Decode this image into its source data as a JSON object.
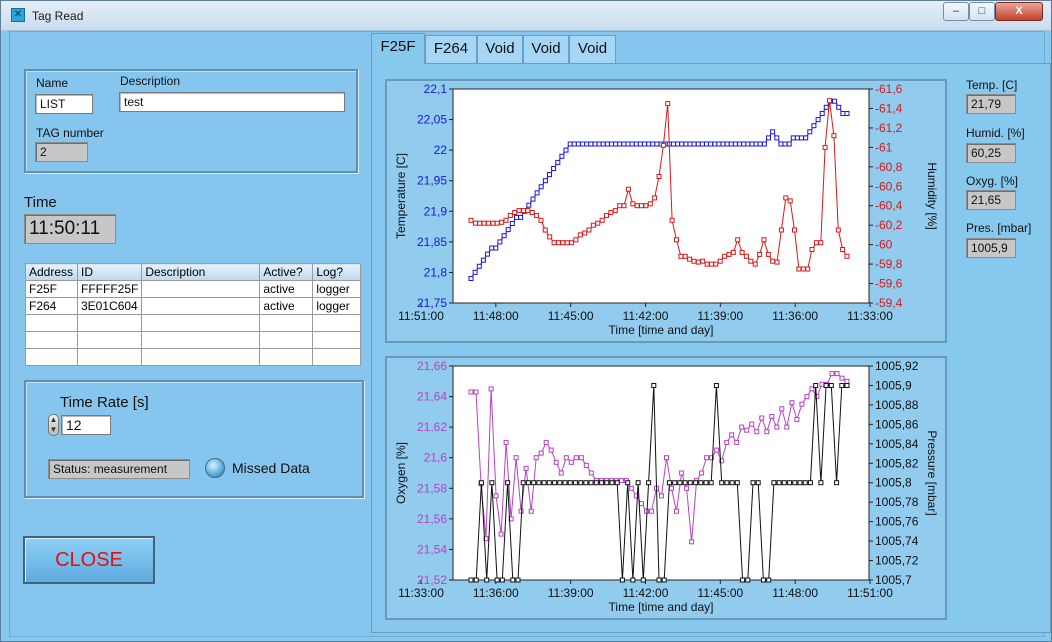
{
  "window": {
    "title": "Tag Read",
    "controls": [
      "–",
      "□",
      "X"
    ]
  },
  "tag_panel": {
    "name_label": "Name",
    "name_value": "LIST",
    "description_label": "Description",
    "description_value": "test",
    "tag_number_label": "TAG number",
    "tag_number_value": "2"
  },
  "time": {
    "label": "Time",
    "value": "11:50:11"
  },
  "tag_table": {
    "columns": [
      "Address",
      "ID",
      "Description",
      "Active?",
      "Log?"
    ],
    "rows": [
      [
        "F25F",
        "FFFFF25F",
        "",
        "active",
        "logger"
      ],
      [
        "F264",
        "3E01C604",
        "",
        "active",
        "logger"
      ],
      [
        "",
        "",
        "",
        "",
        ""
      ],
      [
        "",
        "",
        "",
        "",
        ""
      ],
      [
        "",
        "",
        "",
        "",
        ""
      ]
    ]
  },
  "rate_panel": {
    "label": "Time Rate [s]",
    "value": "12",
    "status": "Status: measurement",
    "missed_data": "Missed Data"
  },
  "close_button": "CLOSE",
  "tabs": [
    "F25F",
    "F264",
    "Void",
    "Void",
    "Void"
  ],
  "readouts": [
    {
      "label": "Temp. [C]",
      "value": "21,79"
    },
    {
      "label": "Humid. [%]",
      "value": "60,25"
    },
    {
      "label": "Oxyg. [%]",
      "value": "21,65"
    },
    {
      "label": "Pres. [mbar]",
      "value": "1005,9"
    }
  ],
  "colors": {
    "temperature": "#1a1ad6",
    "humidity": "#d61a1a",
    "oxygen": "#b542c4",
    "pressure": "#111111",
    "panel": "#87c8ef",
    "close_text": "#e11111"
  },
  "chart_data": [
    {
      "type": "line",
      "xlabel": "Time [time and day]",
      "ylabel": "Temperature [C]",
      "y2label": "Humidity [%]",
      "x_ticks": [
        "11:51:00",
        "11:48:00",
        "11:45:00",
        "11:42:00",
        "11:39:00",
        "11:36:00",
        "11:33:00"
      ],
      "y_ticks": [
        "21,75",
        "21,8",
        "21,85",
        "21,9",
        "21,95",
        "22",
        "22,05",
        "22,1"
      ],
      "y2_ticks": [
        "-59,4",
        "-59,6",
        "-59,8",
        "-60",
        "-60,2",
        "-60,4",
        "-60,6",
        "-60,8",
        "-61",
        "-61,2",
        "-61,4",
        "-61,6"
      ],
      "ylim": [
        21.75,
        22.1
      ],
      "y2lim": [
        -59.4,
        -61.6
      ],
      "series": [
        {
          "name": "Temperature [C]",
          "color": "#1a1ad6",
          "values": [
            21.79,
            21.8,
            21.81,
            21.82,
            21.83,
            21.84,
            21.84,
            21.85,
            21.86,
            21.87,
            21.88,
            21.89,
            21.89,
            21.9,
            21.91,
            21.92,
            21.93,
            21.94,
            21.95,
            21.96,
            21.97,
            21.98,
            21.99,
            22.0,
            22.01,
            22.01,
            22.01,
            22.01,
            22.01,
            22.01,
            22.01,
            22.01,
            22.01,
            22.01,
            22.01,
            22.01,
            22.01,
            22.01,
            22.01,
            22.01,
            22.01,
            22.01,
            22.01,
            22.01,
            22.01,
            22.01,
            22.01,
            22.01,
            22.01,
            22.01,
            22.01,
            22.01,
            22.01,
            22.01,
            22.01,
            22.01,
            22.01,
            22.01,
            22.01,
            22.01,
            22.01,
            22.01,
            22.01,
            22.01,
            22.01,
            22.01,
            22.01,
            22.01,
            22.01,
            22.01,
            22.01,
            22.01,
            22.02,
            22.03,
            22.02,
            22.01,
            22.01,
            22.01,
            22.02,
            22.02,
            22.02,
            22.02,
            22.03,
            22.04,
            22.05,
            22.06,
            22.07,
            22.08,
            22.08,
            22.07,
            22.06,
            22.06
          ]
        },
        {
          "name": "Humidity [%]",
          "color": "#d61a1a",
          "axis": "right",
          "values": [
            -60.25,
            -60.22,
            -60.22,
            -60.22,
            -60.22,
            -60.22,
            -60.22,
            -60.23,
            -60.25,
            -60.3,
            -60.33,
            -60.35,
            -60.35,
            -60.35,
            -60.33,
            -60.3,
            -60.25,
            -60.15,
            -60.08,
            -60.02,
            -60.02,
            -60.02,
            -60.02,
            -60.02,
            -60.05,
            -60.1,
            -60.12,
            -60.15,
            -60.2,
            -60.22,
            -60.25,
            -60.3,
            -60.33,
            -60.35,
            -60.4,
            -60.4,
            -60.57,
            -60.42,
            -60.4,
            -60.4,
            -60.4,
            -60.42,
            -60.48,
            -60.7,
            -61.02,
            -61.45,
            -60.25,
            -60.05,
            -59.88,
            -59.88,
            -59.85,
            -59.83,
            -59.82,
            -59.83,
            -59.8,
            -59.8,
            -59.8,
            -59.83,
            -59.88,
            -59.9,
            -59.92,
            -60.05,
            -59.92,
            -59.88,
            -59.83,
            -59.8,
            -59.9,
            -60.05,
            -59.9,
            -59.83,
            -59.82,
            -60.15,
            -60.48,
            -60.45,
            -60.15,
            -59.75,
            -59.75,
            -59.75,
            -59.95,
            -60.02,
            -60.02,
            -61.0,
            -61.48,
            -61.12,
            -60.15,
            -59.95,
            -59.88
          ]
        }
      ]
    },
    {
      "type": "line",
      "xlabel": "Time [time and day]",
      "ylabel": "Oxygen [%]",
      "y2label": "Pressure [mbar]",
      "x_ticks": [
        "11:33:00",
        "11:36:00",
        "11:39:00",
        "11:42:00",
        "11:45:00",
        "11:48:00",
        "11:51:00"
      ],
      "y_ticks": [
        "21,52",
        "21,54",
        "21,56",
        "21,58",
        "21,6",
        "21,62",
        "21,64",
        "21,66"
      ],
      "y2_ticks": [
        "1005,7",
        "1005,72",
        "1005,74",
        "1005,76",
        "1005,78",
        "1005,8",
        "1005,82",
        "1005,84",
        "1005,86",
        "1005,88",
        "1005,9",
        "1005,92"
      ],
      "ylim": [
        21.52,
        21.66
      ],
      "y2lim": [
        1005.7,
        1005.92
      ],
      "series": [
        {
          "name": "Oxygen [%]",
          "color": "#b542c4",
          "values": [
            21.643,
            21.643,
            21.583,
            21.547,
            21.645,
            21.575,
            21.55,
            21.61,
            21.56,
            21.6,
            21.565,
            21.593,
            21.565,
            21.6,
            21.603,
            21.61,
            21.605,
            21.597,
            21.59,
            21.6,
            21.597,
            21.6,
            21.6,
            21.595,
            21.59,
            21.585,
            21.585,
            21.585,
            21.585,
            21.585,
            21.585,
            21.585,
            21.58,
            21.575,
            21.57,
            21.565,
            21.565,
            21.58,
            21.575,
            21.6,
            21.58,
            21.565,
            21.59,
            21.58,
            21.545,
            21.585,
            21.59,
            21.6,
            21.6,
            21.605,
            21.598,
            21.61,
            21.615,
            21.61,
            21.62,
            21.618,
            21.622,
            21.617,
            21.626,
            21.617,
            21.627,
            21.62,
            21.632,
            21.62,
            21.636,
            21.625,
            21.635,
            21.64,
            21.645,
            21.64,
            21.648,
            21.648,
            21.655,
            21.655,
            21.652,
            21.65
          ]
        },
        {
          "name": "Pressure [mbar]",
          "color": "#111111",
          "axis": "right",
          "values": [
            1005.7,
            1005.7,
            1005.8,
            1005.7,
            1005.8,
            1005.7,
            1005.7,
            1005.8,
            1005.7,
            1005.7,
            1005.8,
            1005.8,
            1005.8,
            1005.8,
            1005.8,
            1005.8,
            1005.8,
            1005.8,
            1005.8,
            1005.8,
            1005.8,
            1005.8,
            1005.8,
            1005.8,
            1005.8,
            1005.8,
            1005.8,
            1005.8,
            1005.8,
            1005.7,
            1005.8,
            1005.7,
            1005.8,
            1005.7,
            1005.8,
            1005.9,
            1005.7,
            1005.7,
            1005.8,
            1005.8,
            1005.8,
            1005.8,
            1005.8,
            1005.8,
            1005.8,
            1005.8,
            1005.8,
            1005.9,
            1005.8,
            1005.8,
            1005.8,
            1005.8,
            1005.7,
            1005.7,
            1005.8,
            1005.8,
            1005.7,
            1005.7,
            1005.8,
            1005.8,
            1005.8,
            1005.8,
            1005.8,
            1005.8,
            1005.8,
            1005.8,
            1005.9,
            1005.8,
            1005.9,
            1005.9,
            1005.8,
            1005.9,
            1005.9
          ]
        }
      ]
    }
  ]
}
